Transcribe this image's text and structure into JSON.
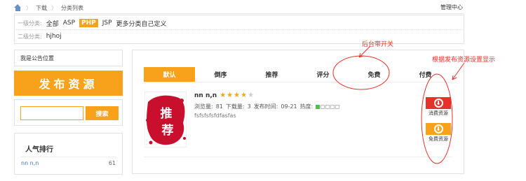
{
  "breadcrumb": {
    "items": [
      "下载",
      "分类列表"
    ]
  },
  "header": {
    "admin_link": "管理中心"
  },
  "categories": {
    "level1_label": "一级分类:",
    "level1_items": [
      "全部",
      "ASP",
      "PHP",
      "JSP",
      "更多分类自己定义"
    ],
    "level1_active": "PHP",
    "level2_label": "二级分类:",
    "level2_items": [
      "hjhoj"
    ]
  },
  "sidebar": {
    "notice": "我是公告位置",
    "publish_label": "发布资源",
    "search": {
      "placeholder": "",
      "button_label": "搜索"
    },
    "popular": {
      "title": "人气排行",
      "items": [
        {
          "name": "nn n,n",
          "count": "61"
        }
      ]
    }
  },
  "main": {
    "tabs": [
      {
        "label": "默认",
        "active": true
      },
      {
        "label": "倒序",
        "active": false
      },
      {
        "label": "推荐",
        "active": false
      },
      {
        "label": "评分",
        "active": false
      },
      {
        "label": "免费",
        "active": false
      },
      {
        "label": "付费",
        "active": false
      }
    ],
    "resource": {
      "thumbnail_text": "推荐",
      "name": "nn n,n",
      "rating": 4,
      "rating_max": 5,
      "views_label": "浏览量:",
      "views": "81",
      "downloads_label": "下载量:",
      "downloads": "3",
      "published_label": "发布时间:",
      "published": "09-21",
      "heat_label": "热度:",
      "heat_level": 1,
      "heat_max": 5,
      "description": "fsfsfsfsfdfasfas"
    },
    "buttons": {
      "paid_label": "消费资源",
      "free_label": "免费资源"
    }
  },
  "annotations": {
    "note1": "后台带开关",
    "note2": "根据发布资源设置显示"
  },
  "colors": {
    "accent": "#f7a21a",
    "danger": "#e5332a",
    "link": "#4a6fb5",
    "heat_on": "#4fc04f"
  }
}
